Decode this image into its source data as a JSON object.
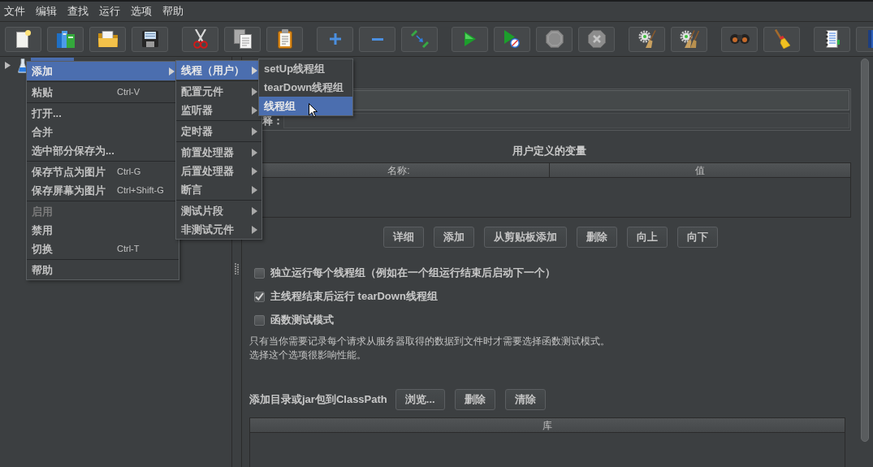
{
  "menu_bar": [
    "文件",
    "编辑",
    "查找",
    "运行",
    "选项",
    "帮助"
  ],
  "tree": {
    "root": {
      "expanded": false,
      "selected": true
    }
  },
  "context_menu": {
    "sections": [
      [
        {
          "label": "添加",
          "submenu": true,
          "selected": true,
          "disabled": false
        }
      ],
      [
        {
          "label": "粘贴",
          "shortcut": "Ctrl-V",
          "submenu": false,
          "selected": false,
          "disabled": false
        }
      ],
      [
        {
          "label": "打开...",
          "submenu": false,
          "selected": false,
          "disabled": false
        },
        {
          "label": "合并",
          "submenu": false,
          "selected": false,
          "disabled": false
        },
        {
          "label": "选中部分保存为...",
          "submenu": false,
          "selected": false,
          "disabled": false
        }
      ],
      [
        {
          "label": "保存节点为图片",
          "shortcut": "Ctrl-G",
          "submenu": false,
          "selected": false,
          "disabled": false
        },
        {
          "label": "保存屏幕为图片",
          "shortcut": "Ctrl+Shift-G",
          "submenu": false,
          "selected": false,
          "disabled": false
        }
      ],
      [
        {
          "label": "启用",
          "submenu": false,
          "selected": false,
          "disabled": true
        },
        {
          "label": "禁用",
          "submenu": false,
          "selected": false,
          "disabled": false
        },
        {
          "label": "切换",
          "shortcut": "Ctrl-T",
          "submenu": false,
          "selected": false,
          "disabled": false
        }
      ],
      [
        {
          "label": "帮助",
          "submenu": false,
          "selected": false,
          "disabled": false
        }
      ]
    ]
  },
  "add_submenu": {
    "sections": [
      [
        {
          "label": "线程（用户）",
          "submenu": true,
          "selected": true
        }
      ],
      [
        {
          "label": "配置元件",
          "submenu": true,
          "selected": false
        },
        {
          "label": "监听器",
          "submenu": true,
          "selected": false
        }
      ],
      [
        {
          "label": "定时器",
          "submenu": true,
          "selected": false
        }
      ],
      [
        {
          "label": "前置处理器",
          "submenu": true,
          "selected": false
        },
        {
          "label": "后置处理器",
          "submenu": true,
          "selected": false
        },
        {
          "label": "断言",
          "submenu": true,
          "selected": false
        }
      ],
      [
        {
          "label": "测试片段",
          "submenu": true,
          "selected": false
        },
        {
          "label": "非测试元件",
          "submenu": true,
          "selected": false
        }
      ]
    ]
  },
  "threads_submenu": {
    "items": [
      {
        "label": "setUp线程组",
        "selected": false
      },
      {
        "label": "tearDown线程组",
        "selected": false
      },
      {
        "label": "线程组",
        "selected": true
      }
    ]
  },
  "test_plan": {
    "comment_label": "释：",
    "variables": {
      "title": "用户定义的变量",
      "columns": [
        "名称:",
        "值"
      ]
    },
    "variable_buttons": [
      "详细",
      "添加",
      "从剪贴板添加",
      "删除",
      "向上",
      "向下"
    ],
    "options": [
      {
        "label": "独立运行每个线程组（例如在一个组运行结束后启动下一个）",
        "checked": false
      },
      {
        "label": "主线程结束后运行 tearDown线程组",
        "checked": true
      },
      {
        "label": "函数测试模式",
        "checked": false
      }
    ],
    "note": [
      "只有当你需要记录每个请求从服务器取得的数据到文件时才需要选择函数测试模式。",
      "选择这个选项很影响性能。"
    ],
    "classpath": {
      "label": "添加目录或jar包到ClassPath",
      "buttons": [
        "浏览...",
        "删除",
        "清除"
      ],
      "columns": [
        "库"
      ]
    }
  }
}
